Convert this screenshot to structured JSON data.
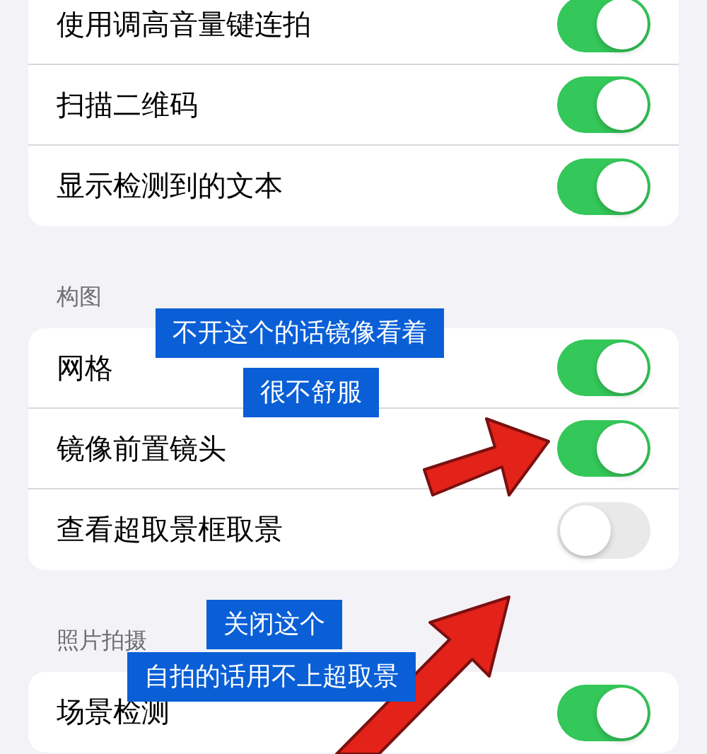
{
  "sections": [
    {
      "rows": [
        {
          "label": "使用调高音量键连拍",
          "on": true
        },
        {
          "label": "扫描二维码",
          "on": true
        },
        {
          "label": "显示检测到的文本",
          "on": true
        }
      ]
    },
    {
      "header": "构图",
      "rows": [
        {
          "label": "网格",
          "on": true
        },
        {
          "label": "镜像前置镜头",
          "on": true
        },
        {
          "label": "查看超取景框取景",
          "on": false
        }
      ]
    },
    {
      "header": "照片拍摄",
      "rows": [
        {
          "label": "场景检测",
          "on": true
        }
      ]
    }
  ],
  "annotations": [
    {
      "text": "不开这个的话镜像看着"
    },
    {
      "text": "很不舒服"
    },
    {
      "text": "关闭这个"
    },
    {
      "text": "自拍的话用不上超取景"
    }
  ]
}
